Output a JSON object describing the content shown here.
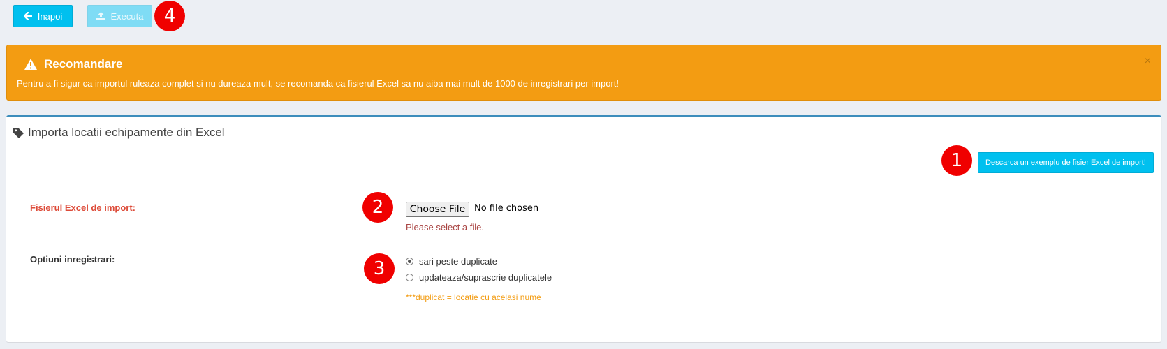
{
  "toolbar": {
    "back_label": "Inapoi",
    "execute_label": "Executa"
  },
  "markers": [
    "1",
    "2",
    "3",
    "4"
  ],
  "alert": {
    "title": "Recomandare",
    "text": "Pentru a fi sigur ca importul ruleaza complet si nu dureaza mult, se recomanda ca fisierul Excel sa nu aiba mai mult de 1000 de inregistrari per import!",
    "close": "×"
  },
  "panel": {
    "title": "Importa locatii echipamente din Excel",
    "download_label": "Descarca un exemplu de fisier Excel de import!"
  },
  "form": {
    "file_label": "Fisierul Excel de import:",
    "file_button": "Choose File",
    "file_status": "No file chosen",
    "file_error": "Please select a file.",
    "options_label": "Optiuni inregistrari:",
    "options": [
      {
        "label": "sari peste duplicate",
        "selected": true
      },
      {
        "label": "updateaza/suprascrie duplicatele",
        "selected": false
      }
    ],
    "note": "***duplicat = locatie cu acelasi nume"
  },
  "colors": {
    "info": "#00c0ef",
    "warning": "#f39c12",
    "danger": "#dd4b39",
    "primary": "#3c8dbc",
    "marker": "#f00000"
  }
}
